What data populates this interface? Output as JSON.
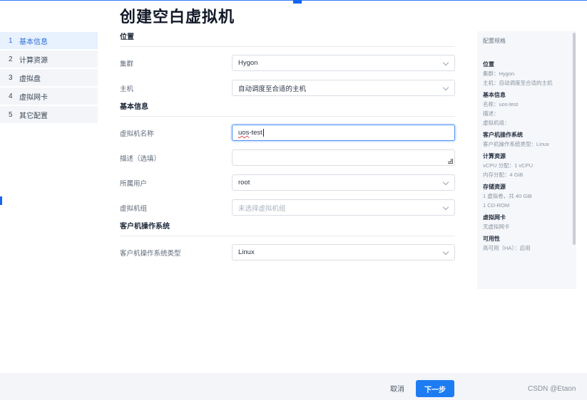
{
  "page_title": "创建空白虚拟机",
  "steps": [
    {
      "num": "1",
      "label": "基本信息"
    },
    {
      "num": "2",
      "label": "计算资源"
    },
    {
      "num": "3",
      "label": "虚拟盘"
    },
    {
      "num": "4",
      "label": "虚拟网卡"
    },
    {
      "num": "5",
      "label": "其它配置"
    }
  ],
  "active_step": 1,
  "form": {
    "location": {
      "title": "位置",
      "cluster": {
        "label": "集群",
        "value": "Hygon"
      },
      "host": {
        "label": "主机",
        "value": "自动调度至合适的主机"
      }
    },
    "basic": {
      "title": "基本信息",
      "vm_name": {
        "label": "虚拟机名称",
        "value_misspelled": "uos",
        "value_rest": "-test"
      },
      "description": {
        "label": "描述（选填）",
        "value": ""
      },
      "owner": {
        "label": "所属用户",
        "value": "root"
      },
      "vm_group": {
        "label": "虚拟机组",
        "placeholder": "未选择虚拟机组"
      }
    },
    "os": {
      "title": "客户机操作系统",
      "os_type": {
        "label": "客户机操作系统类型",
        "value": "Linux"
      }
    }
  },
  "summary": {
    "title": "配置规格",
    "sections": [
      {
        "head": "位置",
        "lines": [
          "集群：Hygon",
          "主机：自动调度至合适的主机"
        ]
      },
      {
        "head": "基本信息",
        "lines": [
          "名称：uos-test",
          "描述：",
          "虚拟机组："
        ]
      },
      {
        "head": "客户机操作系统",
        "lines": [
          "客户机操作系统类型：Linux"
        ]
      },
      {
        "head": "计算资源",
        "lines": [
          "vCPU 分配：1 vCPU",
          "内存分配：4 GiB"
        ]
      },
      {
        "head": "存储资源",
        "lines": [
          "1 虚拟卷，共 40 GiB",
          "1 CD-ROM"
        ]
      },
      {
        "head": "虚拟网卡",
        "lines": [
          "无虚拟网卡"
        ]
      },
      {
        "head": "可用性",
        "lines": [
          "高可用（HA）：启用"
        ]
      }
    ]
  },
  "footer": {
    "cancel_label": "取消",
    "next_label": "下一步",
    "watermark": "CSDN @Etaon"
  },
  "colors": {
    "accent": "#1e7cf2",
    "active_step_bg": "#e8f1fe",
    "panel_bg": "#f5f7fa"
  }
}
